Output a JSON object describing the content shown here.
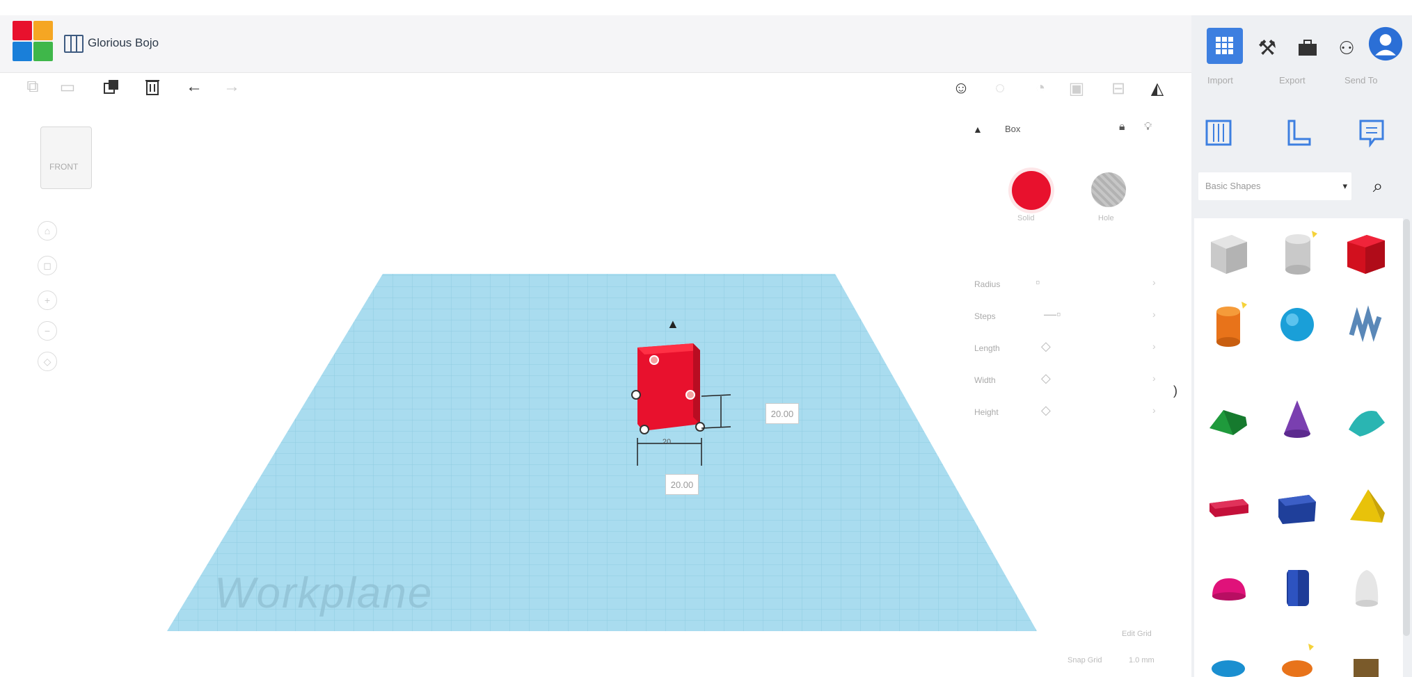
{
  "colors": {
    "accent": "#3d7fe0",
    "solid_red": "#e8112d",
    "hole_gray": "#b9b9b9",
    "workplane_blue": "#a9dcef",
    "header_bg": "#f5f5f7"
  },
  "header": {
    "title": "Glorious Bojo",
    "logo_icon": "tinkercad-logo-icon",
    "doc_icon": "design-grid-icon"
  },
  "toolbar": {
    "left_icons": [
      "copy-icon",
      "paste-icon",
      "duplicate-icon",
      "delete-icon",
      "undo-icon",
      "redo-icon"
    ],
    "right_icons": [
      "note-icon",
      "show-all-icon",
      "light-bulb-icon",
      "group-icon",
      "align-icon",
      "mirror-icon"
    ]
  },
  "right_panel": {
    "top_icons": [
      "3d-view-icon",
      "hammer-icon",
      "briefcase-icon",
      "add-user-icon",
      "user-avatar-icon"
    ],
    "tabs": [
      "Import",
      "Export",
      "Send To"
    ],
    "mode_icons": [
      "workplane-icon",
      "ruler-icon",
      "notes-icon"
    ],
    "shape_category": "Basic Shapes",
    "search_icon": "search-icon",
    "collapse_icon": "chevron-right-icon"
  },
  "inspector": {
    "name": "Box",
    "solid_label": "Solid",
    "hole_label": "Hole",
    "rows": [
      "Radius",
      "Steps",
      "Length",
      "Width",
      "Height"
    ],
    "lock_icon": "lock-icon",
    "light_icon": "light-bulb-icon"
  },
  "viewport": {
    "workplane_label": "Workplane",
    "dim_width": "20.00",
    "dim_height": "20.00",
    "dim_label_small": "20"
  },
  "viewcube": {
    "label": "FRONT"
  },
  "bottom": {
    "edit_grid": "Edit Grid",
    "snap_grid": "Snap Grid",
    "snap_value": "1.0 mm"
  }
}
